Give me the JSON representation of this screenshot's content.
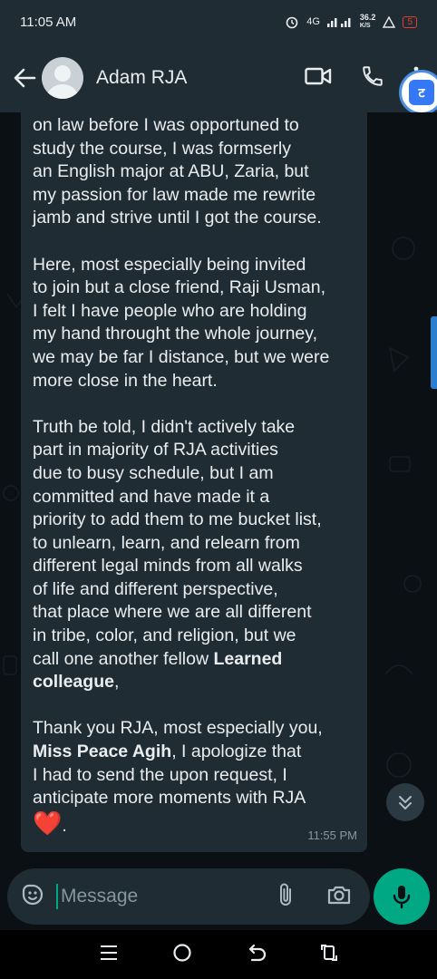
{
  "status_bar": {
    "time": "11:05 AM",
    "network": "4G",
    "speed_value": "36.2",
    "speed_unit": "K/S",
    "battery": "5"
  },
  "header": {
    "contact_name": "Adam RJA",
    "translate_glyph": "ट"
  },
  "message": {
    "paragraphs": [
      [
        "on law before I was opportuned to",
        "study the course, I was formserly",
        "an English major at ABU, Zaria, but",
        "my passion for law made me rewrite",
        "jamb and strive until I got the course."
      ],
      [
        "Here, most especially being invited",
        "to join but a close friend, Raji Usman,",
        "I felt I have people who are holding",
        "my hand throught the whole journey,",
        "we may be far I distance, but we were",
        "more close in the heart."
      ],
      [
        "Truth be told, I didn't actively take",
        "part in majority of RJA activities",
        "due to busy schedule, but I am",
        "committed and have made it a",
        "priority to add them to me bucket list,",
        "to unlearn, learn, and relearn from",
        "different legal minds from all walks",
        "of life and different perspective,",
        "that place where we are all different",
        "in tribe, color, and religion, but we"
      ],
      [
        "Thank you RJA, most especially you,"
      ]
    ],
    "line_call_prefix": "call one another fellow ",
    "bold_learned": "Learned",
    "bold_colleague": "colleague",
    "comma": ",",
    "bold_peace": "Miss Peace Agih",
    "peace_suffix": ", I apologize that",
    "line_send": "I had to send the upon request, I",
    "line_anticipate": "anticipate more moments with RJA",
    "end_dot": ".",
    "time": "11:55 PM"
  },
  "composer": {
    "placeholder": "Message"
  },
  "icons": {
    "back": "back-arrow-icon",
    "video": "video-call-icon",
    "call": "phone-icon",
    "menu": "more-vert-icon",
    "sticker": "sticker-icon",
    "attach": "attach-icon",
    "camera": "camera-icon",
    "mic": "mic-icon"
  },
  "colors": {
    "accent": "#00a884",
    "bubble": "#202c33",
    "header": "#1f2c33",
    "background": "#0b1014",
    "heart": "#e53935"
  }
}
